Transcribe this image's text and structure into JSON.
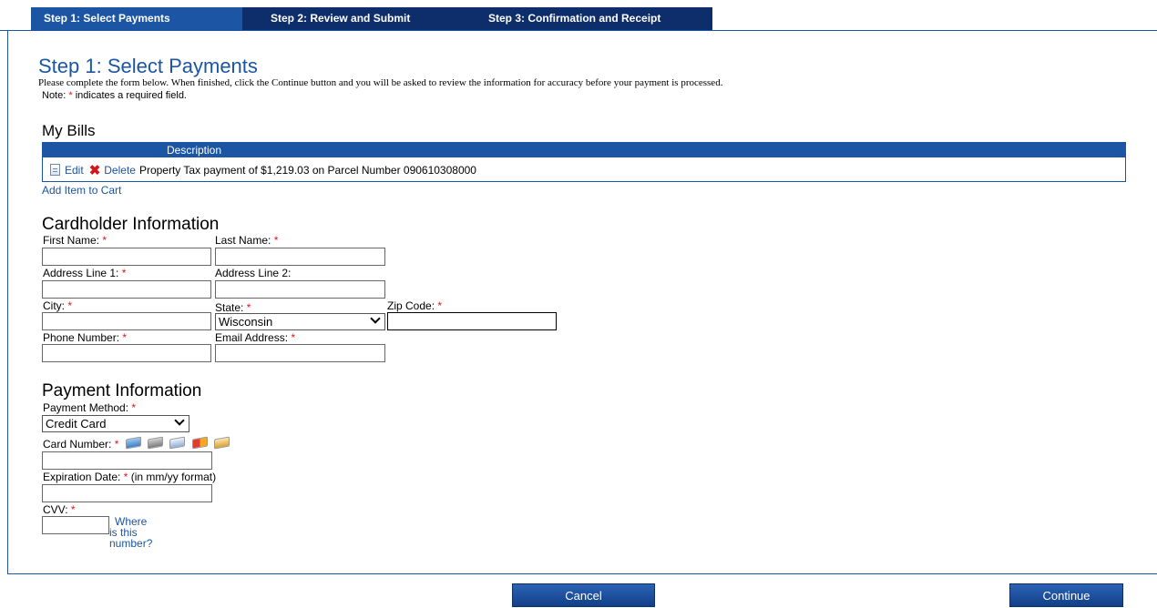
{
  "tabs": [
    {
      "label": "Step 1: Select Payments"
    },
    {
      "label": "Step 2: Review and Submit"
    },
    {
      "label": "Step 3: Confirmation and Receipt"
    }
  ],
  "page": {
    "title": "Step 1: Select Payments",
    "intro": "Please complete the form below. When finished, click the Continue button and you will be asked to review the information for accuracy before your payment is processed.",
    "note_prefix": "Note: ",
    "note_suffix": " indicates a required field.",
    "required_mark": "*"
  },
  "bills": {
    "heading": "My Bills",
    "column": "Description",
    "rows": [
      {
        "edit": "Edit",
        "delete": "Delete",
        "description": "Property Tax payment of $1,219.03 on Parcel Number 090610308000"
      }
    ],
    "add_item": "Add Item to Cart"
  },
  "cardholder": {
    "heading": "Cardholder Information",
    "first_name": "First Name:",
    "last_name": "Last Name:",
    "address1": "Address Line 1:",
    "address2": "Address Line 2:",
    "city": "City:",
    "state": "State:",
    "state_value": "Wisconsin",
    "zip": "Zip Code:",
    "phone": "Phone Number:",
    "email": "Email Address:"
  },
  "payment": {
    "heading": "Payment Information",
    "method": "Payment Method:",
    "method_value": "Credit Card",
    "card_number": "Card Number:",
    "card_icons": [
      "amex-card-icon",
      "discover-card-icon",
      "visa-card-icon",
      "mastercard-card-icon",
      "generic-card-icon"
    ],
    "expiration": "Expiration Date:",
    "expiration_hint": "(in mm/yy format)",
    "cvv": "CVV:",
    "cvv_help": [
      "Where",
      "is this",
      "number?"
    ]
  },
  "buttons": {
    "cancel": "Cancel",
    "continue": "Continue"
  },
  "colors": {
    "accent": "#1c55a4",
    "tab_dark": "#0d2d6b",
    "required": "#e0141b"
  }
}
